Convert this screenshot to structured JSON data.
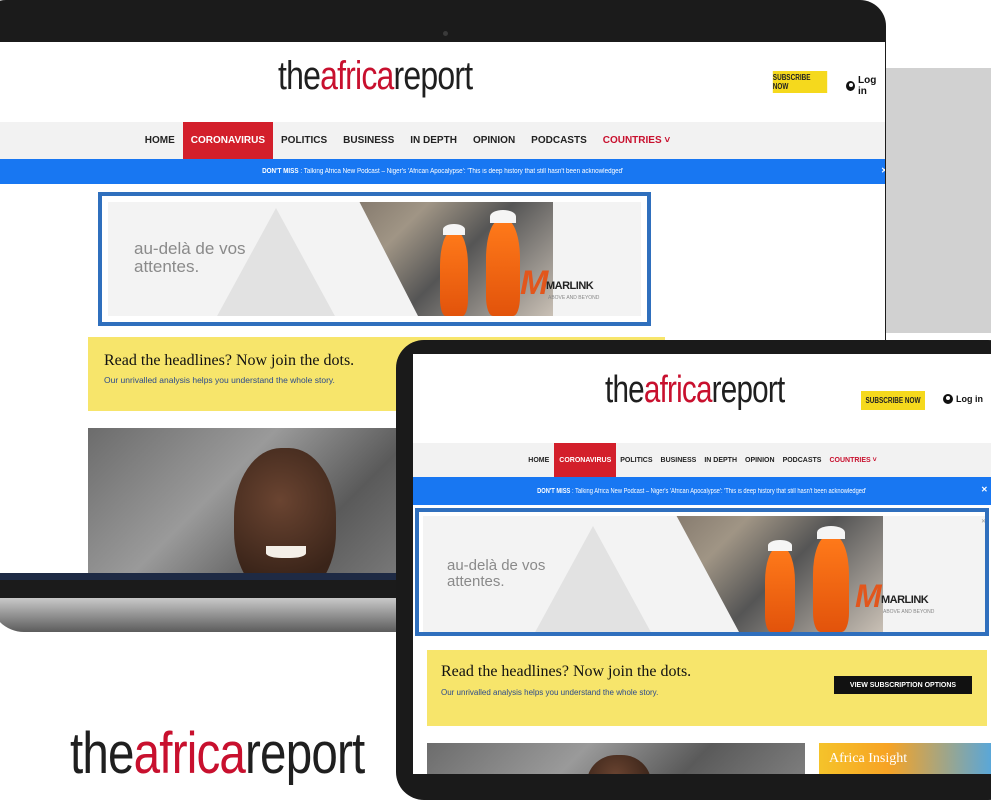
{
  "brand": {
    "logo_prefix": "the",
    "logo_accent": "africa",
    "logo_suffix": "report"
  },
  "header": {
    "subscribe_label": "SUBSCRIBE NOW",
    "login_label": "Log in"
  },
  "nav": {
    "items": [
      {
        "label": "HOME"
      },
      {
        "label": "CORONAVIRUS",
        "active": true
      },
      {
        "label": "POLITICS"
      },
      {
        "label": "BUSINESS"
      },
      {
        "label": "IN DEPTH"
      },
      {
        "label": "OPINION"
      },
      {
        "label": "PODCASTS"
      }
    ],
    "countries_label": "COUNTRIES ˅"
  },
  "ticker": {
    "prefix": "DON'T MISS",
    "separator": " : ",
    "text": "Talking Africa New Podcast – Niger's 'African Apocalypse': 'This is deep history that still hasn't been acknowledged'",
    "close": "✕"
  },
  "ad": {
    "tagline_line1": "au-delà de vos",
    "tagline_line2": "attentes.",
    "brand_mark": "M",
    "brand": "MARLINK",
    "brand_sub": "ABOVE AND BEYOND",
    "close": "✕"
  },
  "promo": {
    "title": "Read the headlines? Now join the dots.",
    "subtitle": "Our unrivalled analysis helps you understand the whole story.",
    "button": "VIEW SUBSCRIPTION OPTIONS"
  },
  "sidebar": {
    "insight_label": "Africa Insight"
  },
  "colors": {
    "accent_red": "#c8102e",
    "nav_active": "#d31f2b",
    "ticker_blue": "#1877f2",
    "subscribe_yellow": "#f5d91d",
    "promo_yellow": "#f7e56b",
    "ad_border": "#2f6fbd"
  }
}
